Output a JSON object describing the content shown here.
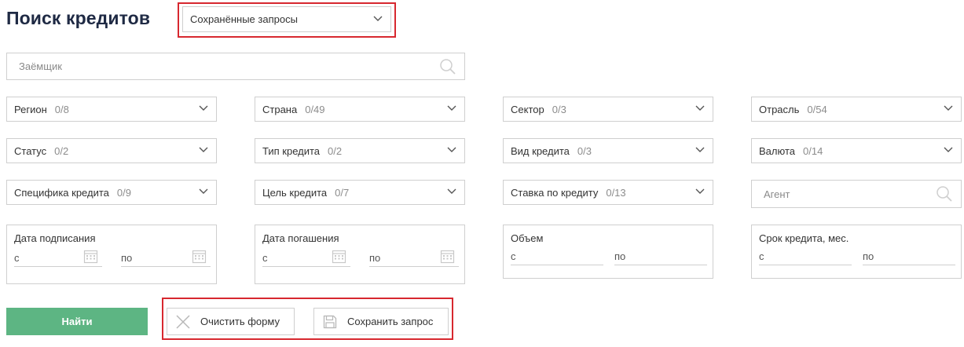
{
  "page": {
    "title": "Поиск кредитов"
  },
  "saved_queries": {
    "label": "Сохранённые запросы"
  },
  "borrower": {
    "placeholder": "Заёмщик"
  },
  "filters": [
    {
      "label": "Регион",
      "count": "0/8"
    },
    {
      "label": "Страна",
      "count": "0/49"
    },
    {
      "label": "Сектор",
      "count": "0/3"
    },
    {
      "label": "Отрасль",
      "count": "0/54"
    },
    {
      "label": "Статус",
      "count": "0/2"
    },
    {
      "label": "Тип кредита",
      "count": "0/2"
    },
    {
      "label": "Вид кредита",
      "count": "0/3"
    },
    {
      "label": "Валюта",
      "count": "0/14"
    },
    {
      "label": "Специфика кредита",
      "count": "0/9"
    },
    {
      "label": "Цель кредита",
      "count": "0/7"
    },
    {
      "label": "Ставка по кредиту",
      "count": "0/13"
    }
  ],
  "agent": {
    "placeholder": "Агент"
  },
  "ranges": [
    {
      "title": "Дата подписания",
      "from": "с",
      "to": "по"
    },
    {
      "title": "Дата погашения",
      "from": "с",
      "to": "по"
    },
    {
      "title": "Объем",
      "from": "с",
      "to": "по"
    },
    {
      "title": "Срок кредита, мес.",
      "from": "с",
      "to": "по"
    }
  ],
  "actions": {
    "find": "Найти",
    "clear": "Очистить форму",
    "save": "Сохранить запрос"
  },
  "colors": {
    "primary_button": "#5db583",
    "highlight_frame": "#d7282f",
    "title_text": "#1f2a44"
  }
}
